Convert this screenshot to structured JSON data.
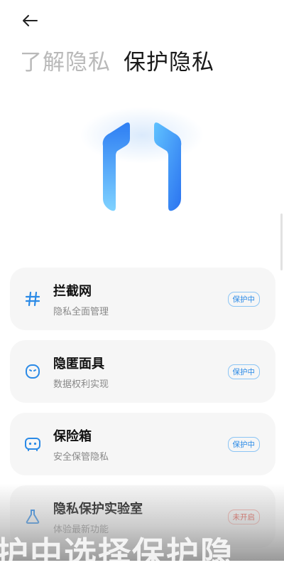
{
  "header": {
    "back_icon": "arrow-left-icon",
    "tabs": [
      {
        "label": "了解隐私",
        "active": false
      },
      {
        "label": "保护隐私",
        "active": true
      }
    ]
  },
  "colors": {
    "accent": "#2b8ae6",
    "badge_off": "#e2574c",
    "card_bg": "#f6f6f6"
  },
  "items": [
    {
      "title": "拦截网",
      "subtitle": "隐私全面管理",
      "status": "保护中",
      "icon": "hash-icon"
    },
    {
      "title": "隐匿面具",
      "subtitle": "数据权利实现",
      "status": "保护中",
      "icon": "mask-icon"
    },
    {
      "title": "保险箱",
      "subtitle": "安全保管隐私",
      "status": "保护中",
      "icon": "safe-box-icon"
    },
    {
      "title": "隐私保护实验室",
      "subtitle": "体验最新功能",
      "status": "未开启",
      "icon": "flask-icon"
    }
  ],
  "overlay_caption": "护中选择保护隐"
}
